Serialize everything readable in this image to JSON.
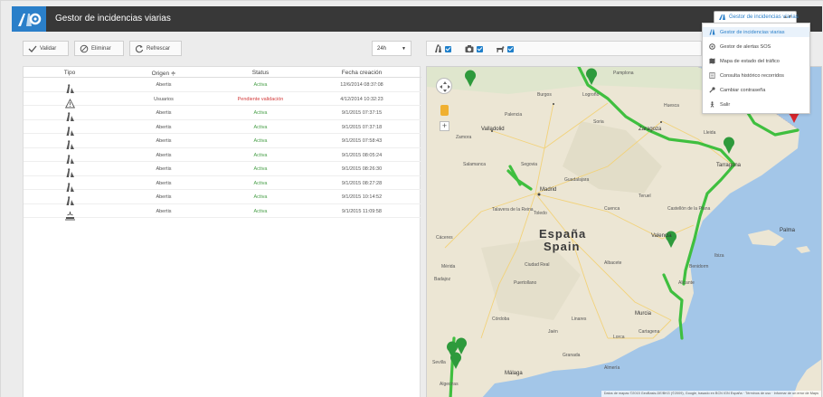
{
  "header": {
    "title": "Gestor de incidencias viarias",
    "selector_value": "Gestor de incidencias viarias"
  },
  "toolbar": {
    "validar": "Validar",
    "eliminar": "Eliminar",
    "refrescar": "Refrescar",
    "period": "24h"
  },
  "table": {
    "columns": [
      "Tipo",
      "Origen ≑",
      "Status",
      "Fecha creación"
    ],
    "rows": [
      {
        "tipo": "works",
        "origen": "Abertis",
        "status": "Activa",
        "fecha": "12/6/2014 08:37:08"
      },
      {
        "tipo": "warning",
        "origen": "Usuarios",
        "status": "Pendiente validación",
        "fecha": "4/12/2014 10:32:23"
      },
      {
        "tipo": "works",
        "origen": "Abertis",
        "status": "Activa",
        "fecha": "9/1/2015 07:37:15"
      },
      {
        "tipo": "works",
        "origen": "Abertis",
        "status": "Activa",
        "fecha": "9/1/2015 07:37:18"
      },
      {
        "tipo": "works",
        "origen": "Abertis",
        "status": "Activa",
        "fecha": "9/1/2015 07:58:43"
      },
      {
        "tipo": "works",
        "origen": "Abertis",
        "status": "Activa",
        "fecha": "9/1/2015 08:05:24"
      },
      {
        "tipo": "works",
        "origen": "Abertis",
        "status": "Activa",
        "fecha": "9/1/2015 08:26:30"
      },
      {
        "tipo": "works",
        "origen": "Abertis",
        "status": "Activa",
        "fecha": "9/1/2015 08:27:28"
      },
      {
        "tipo": "works",
        "origen": "Abertis",
        "status": "Activa",
        "fecha": "9/1/2015 10:14:52"
      },
      {
        "tipo": "incident",
        "origen": "Abertis",
        "status": "Activa",
        "fecha": "9/1/2015 11:09:58"
      }
    ]
  },
  "dropdown": {
    "items": [
      {
        "label": "Gestor de incidencias viarias",
        "icon": "road-works-icon",
        "selected": true
      },
      {
        "label": "Gestor de alertas SOS",
        "icon": "sos-alert-icon",
        "selected": false
      },
      {
        "label": "Mapa de estado del tráfico",
        "icon": "map-icon",
        "selected": false
      },
      {
        "label": "Consulta histórico recorridos",
        "icon": "history-icon",
        "selected": false
      },
      {
        "label": "Cambiar contraseña",
        "icon": "key-icon",
        "selected": false
      },
      {
        "label": "Salir",
        "icon": "exit-icon",
        "selected": false
      }
    ]
  },
  "map": {
    "labels": {
      "country_es": "España",
      "country_en": "Spain",
      "madrid": "Madrid",
      "zaragoza": "Zaragoza",
      "valladolid": "Valladolid",
      "salamanca": "Salamanca",
      "burgos": "Burgos",
      "palencia": "Palencia",
      "zamora": "Zamora",
      "segovia": "Segovia",
      "guadalajara": "Guadalajara",
      "cuenca": "Cuenca",
      "toledo": "Toledo",
      "talavera": "Talavera de la Reina",
      "caceres": "Cáceres",
      "merida": "Mérida",
      "badajoz": "Badajoz",
      "ciudad_real": "Ciudad Real",
      "albacete": "Albacete",
      "cordoba": "Córdoba",
      "jaen": "Jaén",
      "granada": "Granada",
      "malaga": "Málaga",
      "murcia": "Murcia",
      "cartagena": "Cartagena",
      "alicante": "Alicante",
      "valencia": "Valencia",
      "castellon": "Castellón de la Plana",
      "tarragona": "Tarragona",
      "lleida": "Lleida",
      "huesca": "Huesca",
      "teruel": "Teruel",
      "soria": "Soria",
      "logrono": "Logroño",
      "pamplona": "Pamplona",
      "palma": "Palma",
      "puertollano": "Puertollano",
      "linares": "Linares",
      "ibiza": "Ibiza",
      "almeria": "Almería",
      "algeciras": "Algeciras",
      "sevilla": "Sevilla",
      "benidorm": "Benidorm",
      "lorca": "Lorca"
    },
    "attribution": "Datos de mapas ©2015 GeoBasis-DE/BKG (©2009), Google, basado en BCN IGN España · Términos de uso · Informar de un error de Maps"
  },
  "colors": {
    "accent": "#2a7fc9",
    "header_bg": "#383838",
    "status_active": "#4aa04a",
    "status_pending": "#d33b3b",
    "route": "#3fbf3f"
  }
}
